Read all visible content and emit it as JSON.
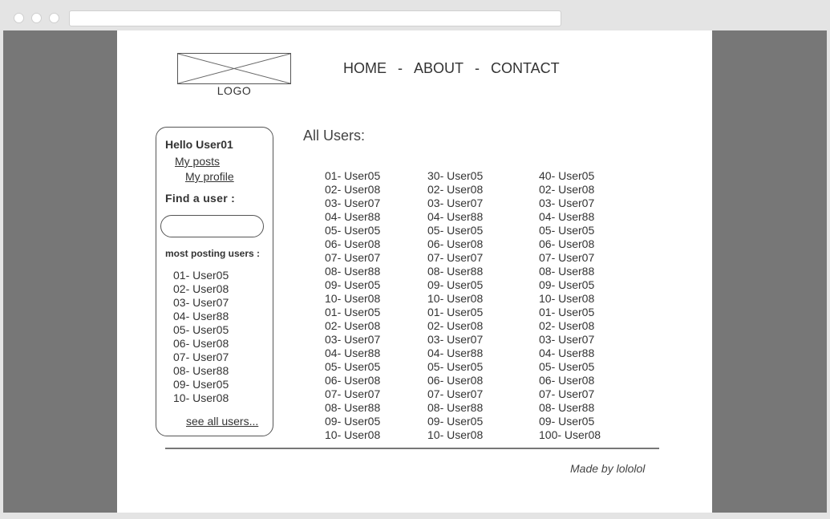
{
  "logo": {
    "label": "LOGO"
  },
  "nav": {
    "home": "HOME",
    "about": "ABOUT",
    "contact": "CONTACT",
    "separator": "-"
  },
  "sidebar": {
    "greeting": "Hello User01",
    "links": [
      "My posts",
      "My profile"
    ],
    "find_label": "Find a user :",
    "search_value": "",
    "most_posting_label": "most posting users :",
    "top_users": [
      "01- User05",
      "02- User08",
      "03- User07",
      "04- User88",
      "05- User05",
      "06- User08",
      "07- User07",
      "08- User88",
      "09- User05",
      "10- User08"
    ],
    "see_all": "see all users..."
  },
  "main": {
    "title": "All Users:",
    "columns": [
      [
        "01- User05",
        "02- User08",
        "03- User07",
        "04- User88",
        "05- User05",
        "06- User08",
        "07- User07",
        "08- User88",
        "09- User05",
        "10- User08",
        "01- User05",
        "02- User08",
        "03- User07",
        "04- User88",
        "05- User05",
        "06- User08",
        "07- User07",
        "08- User88",
        "09- User05",
        "10- User08"
      ],
      [
        "30- User05",
        "02- User08",
        "03- User07",
        "04- User88",
        "05- User05",
        "06- User08",
        "07- User07",
        "08- User88",
        "09- User05",
        "10- User08",
        "01- User05",
        "02- User08",
        "03- User07",
        "04- User88",
        "05- User05",
        "06- User08",
        "07- User07",
        "08- User88",
        "09- User05",
        "10- User08"
      ],
      [
        "40- User05",
        "02- User08",
        "03- User07",
        "04- User88",
        "05- User05",
        "06- User08",
        "07- User07",
        "08- User88",
        "09- User05",
        "10- User08",
        "01- User05",
        "02- User08",
        "03- User07",
        "04- User88",
        "05- User05",
        "06- User08",
        "07- User07",
        "08- User88",
        "09- User05",
        "100- User08"
      ]
    ]
  },
  "footer": {
    "text": "Made by lololol"
  }
}
